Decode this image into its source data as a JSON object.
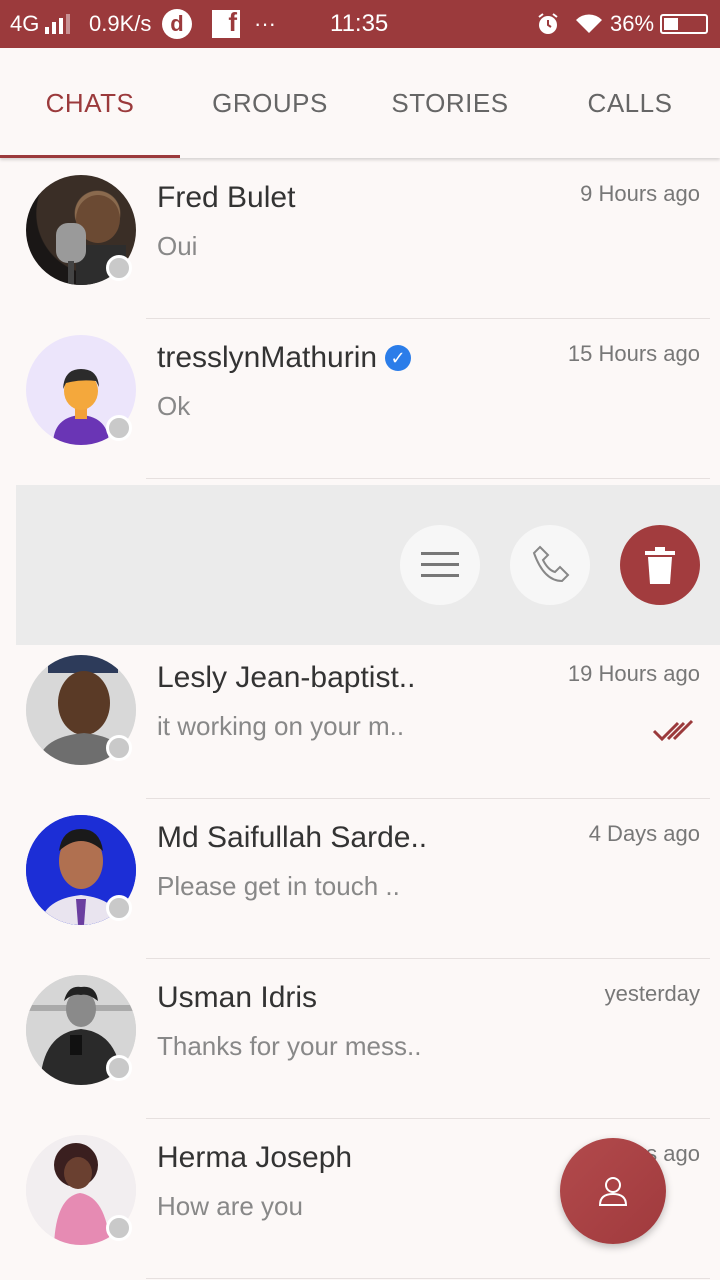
{
  "status_bar": {
    "network": "4G",
    "speed": "0.9K/s",
    "app_icon_letter": "d",
    "fb_letter": "f",
    "more": "···",
    "time": "11:35",
    "battery_percent": "36%",
    "battery_level": 0.36
  },
  "tabs": [
    {
      "label": "CHATS",
      "active": true
    },
    {
      "label": "GROUPS",
      "active": false
    },
    {
      "label": "STORIES",
      "active": false
    },
    {
      "label": "CALLS",
      "active": false
    }
  ],
  "chats": [
    {
      "name": "Fred Bulet",
      "message": "Oui",
      "time": "9 Hours ago",
      "verified": false
    },
    {
      "name": "tresslynMathurin",
      "message": "Ok",
      "time": "15 Hours ago",
      "verified": true
    },
    {
      "name": "Lesly Jean-baptist..",
      "message": "it working on your m..",
      "time": "19 Hours ago",
      "read_ticks": true
    },
    {
      "name": "Md Saifullah Sarde..",
      "message": "Please get in touch ..",
      "time": "4 Days ago"
    },
    {
      "name": "Usman Idris",
      "message": "Thanks for your mess..",
      "time": "yesterday"
    },
    {
      "name": "Herma Joseph",
      "message": "How are  you",
      "time": "1 Days ago"
    }
  ],
  "swipe_actions": [
    "menu-icon",
    "phone-icon",
    "trash-icon"
  ],
  "fab_icon": "person-icon",
  "colors": {
    "accent": "#9b3a3c",
    "verified": "#2b7de9",
    "delete": "#a23c3e"
  }
}
